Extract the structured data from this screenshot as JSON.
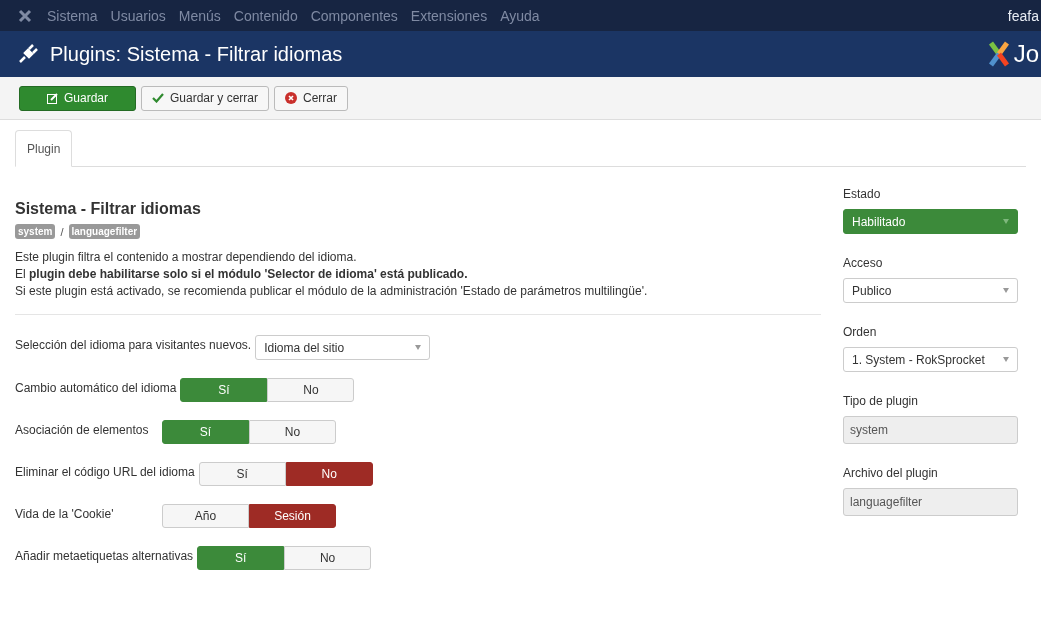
{
  "top_menu": {
    "items": [
      "Sistema",
      "Usuarios",
      "Menús",
      "Contenido",
      "Componentes",
      "Extensiones",
      "Ayuda"
    ],
    "user": "feafa"
  },
  "header": {
    "title": "Plugins: Sistema - Filtrar idiomas",
    "logo_text": "Jo"
  },
  "toolbar": {
    "buttons": [
      {
        "label": "Guardar",
        "kind": "primary"
      },
      {
        "label": "Guardar y cerrar",
        "kind": "check"
      },
      {
        "label": "Cerrar",
        "kind": "close"
      }
    ]
  },
  "tabs": [
    {
      "label": "Plugin",
      "selected": true
    }
  ],
  "plugin": {
    "title": "Sistema - Filtrar idiomas",
    "tags": [
      "system",
      "languagefilter"
    ],
    "separator": "/",
    "description": [
      "Este plugin filtra el contenido a mostrar dependiendo del idioma.",
      "El **plugin debe habilitarse solo si el módulo 'Selector de idioma' está publicado.**",
      "Si este plugin está activado, se recomienda publicar el módulo de la administración 'Estado de parámetros multilingüe'."
    ]
  },
  "settings": [
    {
      "kind": "select",
      "label": "Selección del idioma para visitantes nuevos.",
      "value": "Idioma del sitio"
    },
    {
      "kind": "toggle",
      "label": "Cambio automático del idioma",
      "color": "#3c8a3a",
      "options": [
        {
          "label": "Sí",
          "selected": true
        },
        {
          "label": "No",
          "selected": false
        }
      ]
    },
    {
      "kind": "toggle",
      "label": "Asociación de elementos",
      "color": "#3c8a3a",
      "options": [
        {
          "label": "Sí",
          "selected": true
        },
        {
          "label": "No",
          "selected": false
        }
      ]
    },
    {
      "kind": "toggle",
      "label": "Eliminar el código URL del idioma",
      "color": "#9e2b25",
      "options": [
        {
          "label": "Sí",
          "selected": false
        },
        {
          "label": "No",
          "selected": true
        }
      ]
    },
    {
      "kind": "toggle",
      "label": "Vida de la 'Cookie'",
      "color": "#9e2b25",
      "options": [
        {
          "label": "Año",
          "selected": false
        },
        {
          "label": "Sesión",
          "selected": true
        }
      ]
    },
    {
      "kind": "toggle",
      "label": "Añadir metaetiquetas alternativas",
      "color": "#3c8a3a",
      "options": [
        {
          "label": "Sí",
          "selected": true
        },
        {
          "label": "No",
          "selected": false
        }
      ]
    }
  ],
  "sidebar": [
    {
      "kind": "select",
      "label": "Estado",
      "value": "Habilitado",
      "color": "#3c8a3a"
    },
    {
      "kind": "select",
      "label": "Acceso",
      "value": "Publico"
    },
    {
      "kind": "select",
      "label": "Orden",
      "value": "1. System - RokSprocket"
    },
    {
      "kind": "readonly",
      "label": "Tipo de plugin",
      "value": "system"
    },
    {
      "kind": "readonly",
      "label": "Archivo del plugin",
      "value": "languagefilter"
    }
  ]
}
